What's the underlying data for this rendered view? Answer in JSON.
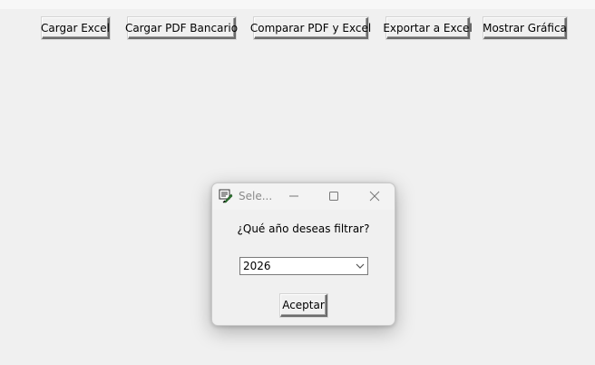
{
  "toolbar": {
    "buttons": [
      {
        "label": "Cargar Excel"
      },
      {
        "label": "Cargar PDF Bancario"
      },
      {
        "label": "Comparar PDF y Excel"
      },
      {
        "label": "Exportar a Excel"
      },
      {
        "label": "Mostrar Gráfica"
      }
    ]
  },
  "dialog": {
    "title": "Sele...",
    "icon": "tk-feather-icon",
    "window_controls": [
      "minimize-icon",
      "maximize-icon",
      "close-icon"
    ],
    "prompt": "¿Qué año deseas filtrar?",
    "year_select": {
      "value": "2026"
    },
    "accept_label": "Aceptar"
  },
  "colors": {
    "background": "#f0f0f0",
    "title_text": "#8a8a8a"
  }
}
